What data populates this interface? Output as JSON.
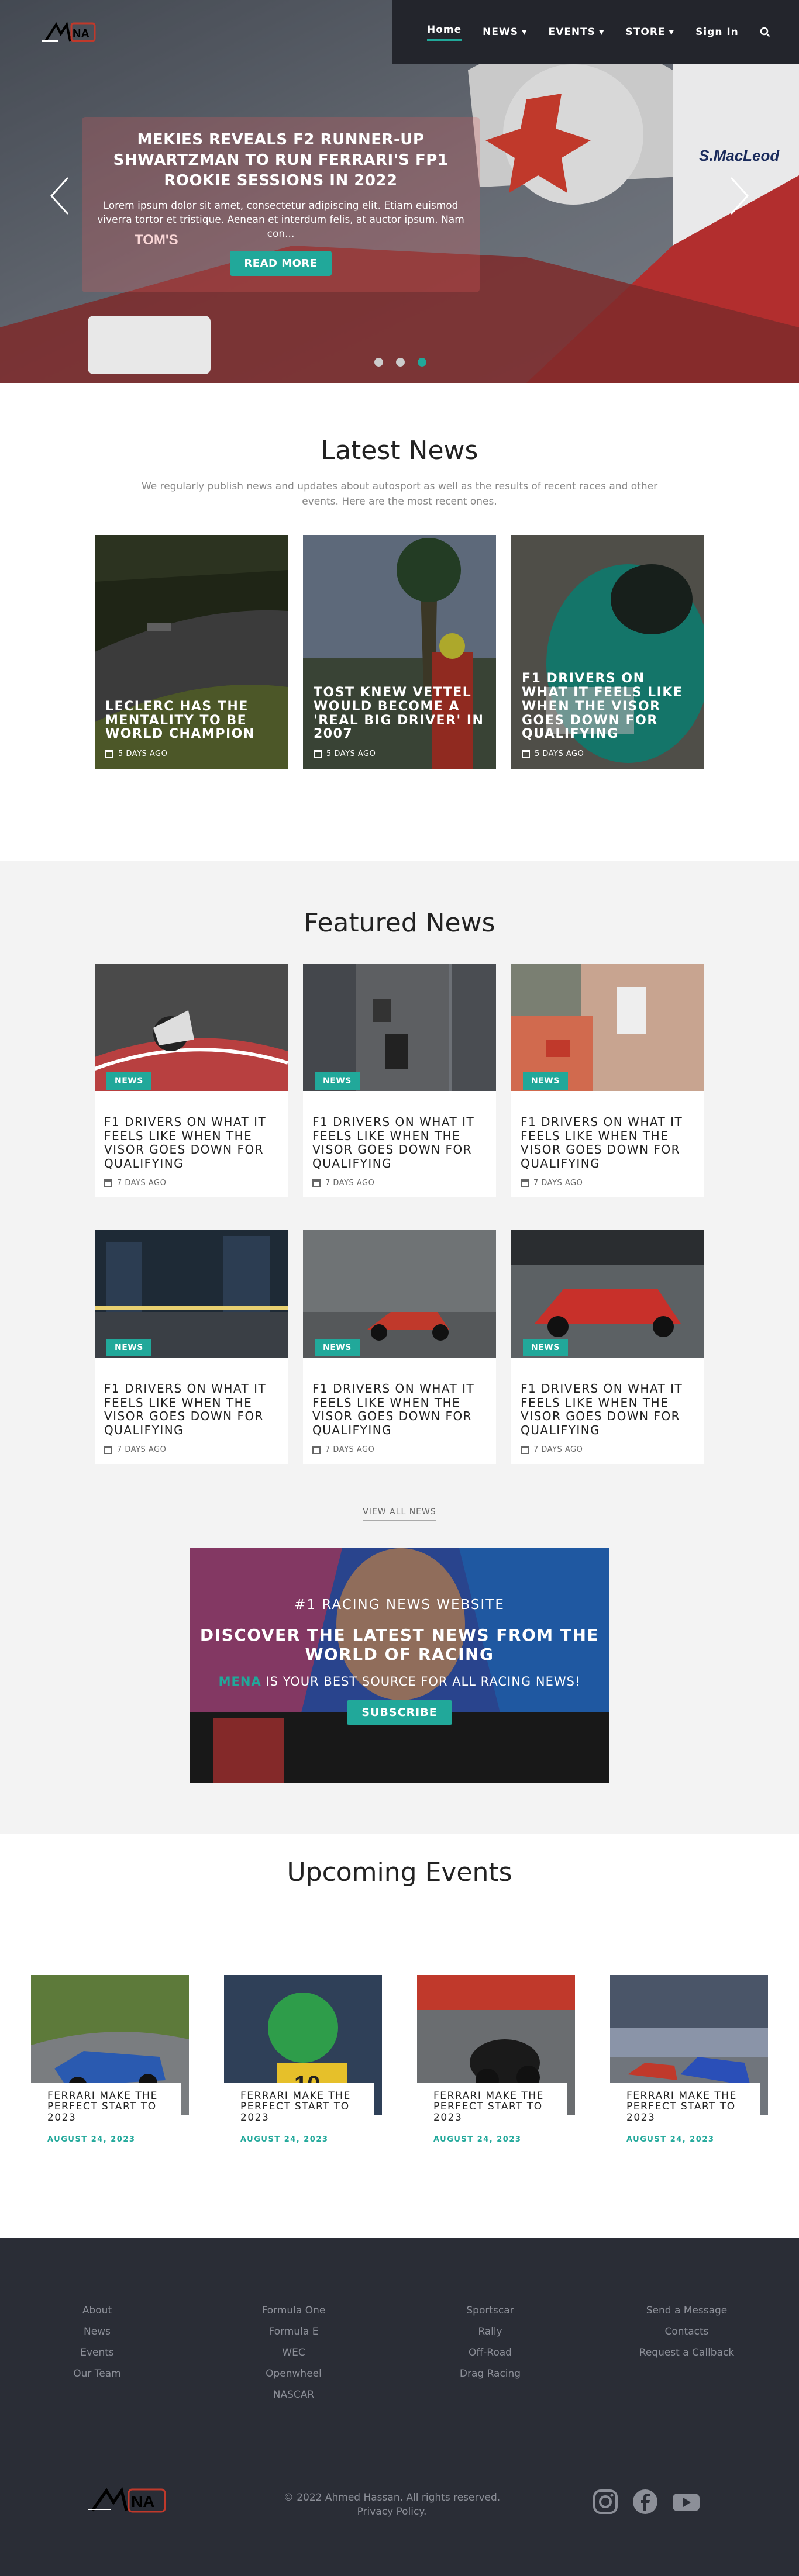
{
  "nav": {
    "logo_text": "MENA",
    "items": [
      {
        "label": "Home"
      },
      {
        "label": "NEWS"
      },
      {
        "label": "EVENTS"
      },
      {
        "label": "STORE"
      },
      {
        "label": "Sign In"
      }
    ]
  },
  "hero": {
    "title": "MEKIES REVEALS F2 RUNNER-UP SHWARTZMAN TO RUN FERRARI'S FP1 ROOKIE SESSIONS IN 2022",
    "text": "Lorem ipsum dolor sit amet, consectetur adipiscing elit. Etiam euismod viverra tortor et tristique. Aenean et interdum felis, at auctor ipsum. Nam con...",
    "button": "READ MORE",
    "slide_count": 3,
    "active_slide": 3,
    "bg_text": "S.MacLeod",
    "bg_text2": "TOM'S"
  },
  "latest": {
    "title": "Latest News",
    "subtitle": "We regularly publish news and updates about autosport as well as the results of recent races and other events. Here are the most recent ones.",
    "items": [
      {
        "title": "LECLERC HAS THE MENTALITY TO BE WORLD CHAMPION",
        "date": "5 DAYS AGO"
      },
      {
        "title": "TOST KNEW VETTEL WOULD BECOME A 'REAL BIG DRIVER' IN 2007",
        "date": "5 DAYS AGO"
      },
      {
        "title": "F1 DRIVERS ON WHAT IT FEELS LIKE WHEN THE VISOR GOES DOWN FOR QUALIFYING",
        "date": "5 DAYS AGO"
      }
    ]
  },
  "featured": {
    "title": "Featured News",
    "badge": "NEWS",
    "items": [
      {
        "title": "F1 DRIVERS ON WHAT IT FEELS LIKE WHEN THE VISOR GOES DOWN FOR QUALIFYING",
        "date": "7 DAYS AGO"
      },
      {
        "title": "F1 DRIVERS ON WHAT IT FEELS LIKE WHEN THE VISOR GOES DOWN FOR QUALIFYING",
        "date": "7 DAYS AGO"
      },
      {
        "title": "F1 DRIVERS ON WHAT IT FEELS LIKE WHEN THE VISOR GOES DOWN FOR QUALIFYING",
        "date": "7 DAYS AGO"
      },
      {
        "title": "F1 DRIVERS ON WHAT IT FEELS LIKE WHEN THE VISOR GOES DOWN FOR QUALIFYING",
        "date": "7 DAYS AGO"
      },
      {
        "title": "F1 DRIVERS ON WHAT IT FEELS LIKE WHEN THE VISOR GOES DOWN FOR QUALIFYING",
        "date": "7 DAYS AGO"
      },
      {
        "title": "F1 DRIVERS ON WHAT IT FEELS LIKE WHEN THE VISOR GOES DOWN FOR QUALIFYING",
        "date": "7 DAYS AGO"
      }
    ],
    "view_all": "VIEW ALL NEWS"
  },
  "promo": {
    "line1": "#1 RACING NEWS WEBSITE",
    "line2": "DISCOVER THE LATEST NEWS FROM THE WORLD OF RACING",
    "brand": "MENA",
    "line3": " IS YOUR BEST SOURCE FOR ALL RACING NEWS!",
    "button": "SUBSCRIBE"
  },
  "events": {
    "title": "Upcoming Events",
    "items": [
      {
        "title": "FERRARI MAKE THE PERFECT START TO 2023",
        "date": "AUGUST 24, 2023"
      },
      {
        "title": "FERRARI MAKE THE PERFECT START TO 2023",
        "date": "AUGUST 24, 2023"
      },
      {
        "title": "FERRARI MAKE THE PERFECT START TO 2023",
        "date": "AUGUST 24, 2023"
      },
      {
        "title": "FERRARI MAKE THE PERFECT START TO 2023",
        "date": "AUGUST 24, 2023"
      }
    ]
  },
  "footer": {
    "col1": [
      "About",
      "News",
      "Events",
      "Our Team"
    ],
    "col2": [
      "Formula One",
      "Formula E",
      "WEC",
      "Openwheel",
      "NASCAR"
    ],
    "col3": [
      "Sportscar",
      "Rally",
      "Off-Road",
      "Drag Racing"
    ],
    "col4": [
      "Send a Message",
      "Contacts",
      "Request a Callback"
    ],
    "copyright": "© 2022 Ahmed Hassan. All rights reserved.",
    "privacy": "Privacy Policy."
  },
  "colors": {
    "accent": "#21a89a",
    "dark": "#23252c",
    "footer": "#2a2d36"
  },
  "icons": [
    "search-icon",
    "chevron-down-icon",
    "calendar-icon",
    "arrow-left-icon",
    "arrow-right-icon",
    "instagram-icon",
    "facebook-icon",
    "youtube-icon"
  ]
}
